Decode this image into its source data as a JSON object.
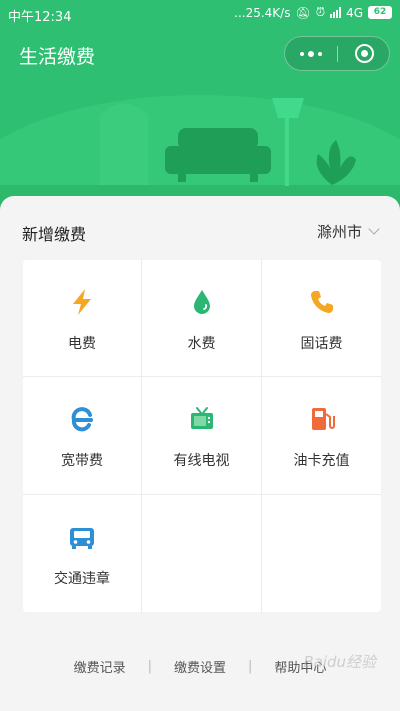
{
  "status_bar": {
    "time": "中午12:34",
    "net_speed": "...25.4K/s",
    "network": "4G",
    "battery": "62"
  },
  "header": {
    "title": "生活缴费"
  },
  "new_payment": {
    "title": "新增缴费",
    "city": "滁州市"
  },
  "services": [
    {
      "label": "电费",
      "icon": "lightning-icon",
      "color": "#f5a623"
    },
    {
      "label": "水费",
      "icon": "water-drop-icon",
      "color": "#2bb673"
    },
    {
      "label": "固话费",
      "icon": "phone-icon",
      "color": "#f5a623"
    },
    {
      "label": "宽带费",
      "icon": "broadband-icon",
      "color": "#2d8fd5"
    },
    {
      "label": "有线电视",
      "icon": "tv-icon",
      "color": "#2bb673"
    },
    {
      "label": "油卡充值",
      "icon": "fuel-pump-icon",
      "color": "#f06a3a"
    },
    {
      "label": "交通违章",
      "icon": "car-icon",
      "color": "#2d8fd5"
    }
  ],
  "footer": {
    "records": "缴费记录",
    "settings": "缴费设置",
    "help": "帮助中心"
  },
  "watermark": "Baidu经验",
  "colors": {
    "header_bg": "#2fbf72"
  }
}
